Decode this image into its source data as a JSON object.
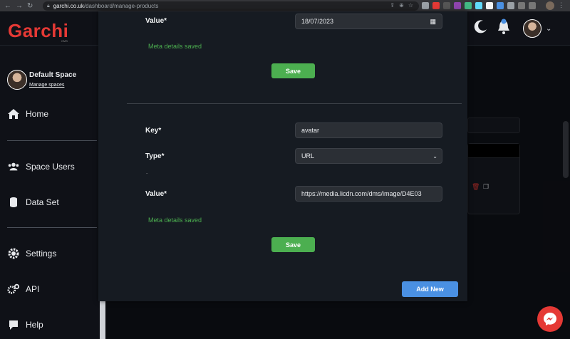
{
  "browser": {
    "url_host": "garchi.co.uk",
    "url_path": "/dashboard/manage-products"
  },
  "header": {
    "logo": "Garchi",
    "logo_sub": "CMS"
  },
  "sidebar": {
    "space_name": "Default Space",
    "manage_link": "Manage spaces",
    "items": [
      {
        "label": "Home"
      },
      {
        "label": "Space Users"
      },
      {
        "label": "Data Set"
      },
      {
        "label": "Settings"
      },
      {
        "label": "API"
      },
      {
        "label": "Help"
      }
    ]
  },
  "modal": {
    "meta1": {
      "value_label": "Value*",
      "value": "18/07/2023",
      "status": "Meta details saved",
      "save_label": "Save"
    },
    "meta2": {
      "key_label": "Key*",
      "key_value": "avatar",
      "type_label": "Type*",
      "type_value": "URL",
      "value_label": "Value*",
      "value": "https://media.licdn.com/dms/image/D4E03",
      "status": "Meta details saved",
      "save_label": "Save"
    },
    "add_new_label": "Add New"
  },
  "colors": {
    "brand": "#e53935",
    "success": "#4caf50",
    "primary": "#4a90e2"
  }
}
